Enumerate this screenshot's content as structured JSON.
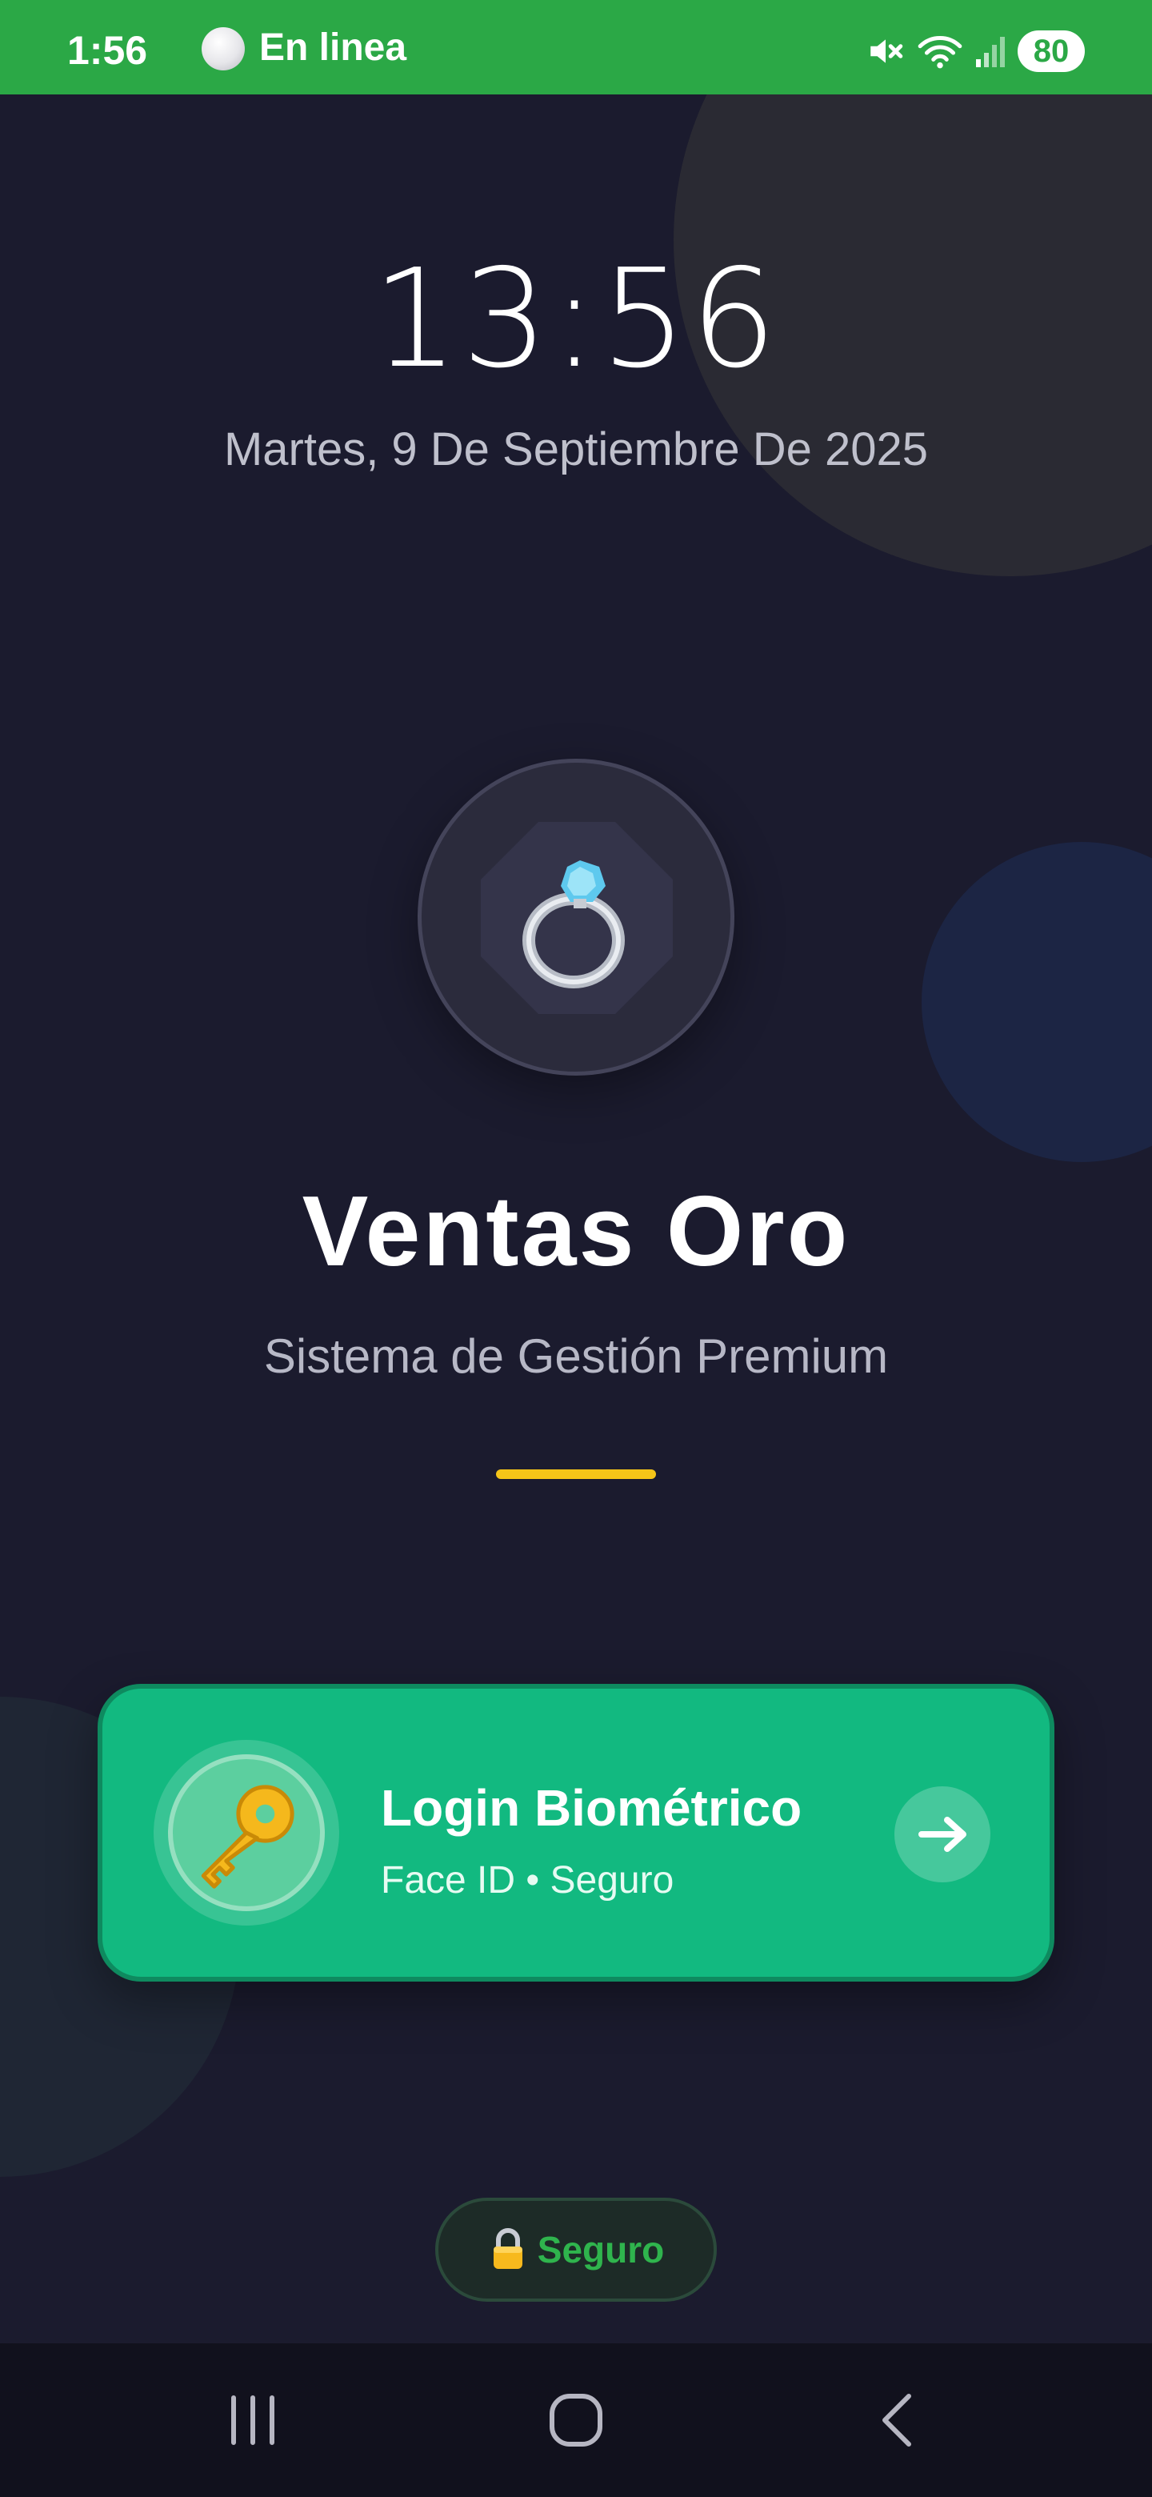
{
  "status_bar": {
    "time": "1:56",
    "online_label": "En linea",
    "battery": "80"
  },
  "lock": {
    "clock": "13:56",
    "date": "Martes, 9 De Septiembre De 2025"
  },
  "brand": {
    "logo_icon": "ring-icon",
    "title": "Ventas Oro",
    "subtitle": "Sistema de Gestión Premium",
    "accent_color": "#f5c518"
  },
  "login_card": {
    "icon": "key-icon",
    "title": "Login Biométrico",
    "subtitle": "Face ID • Seguro",
    "action_icon": "arrow-right-icon",
    "color": "#12b980"
  },
  "secure_badge": {
    "icon": "lock-icon",
    "label": "Seguro",
    "color": "#2fb44d"
  },
  "nav": {
    "recent_icon": "recent-apps-icon",
    "home_icon": "home-icon",
    "back_icon": "back-icon"
  },
  "colors": {
    "status_bar": "#2ba846",
    "background": "#1b1b2e"
  }
}
